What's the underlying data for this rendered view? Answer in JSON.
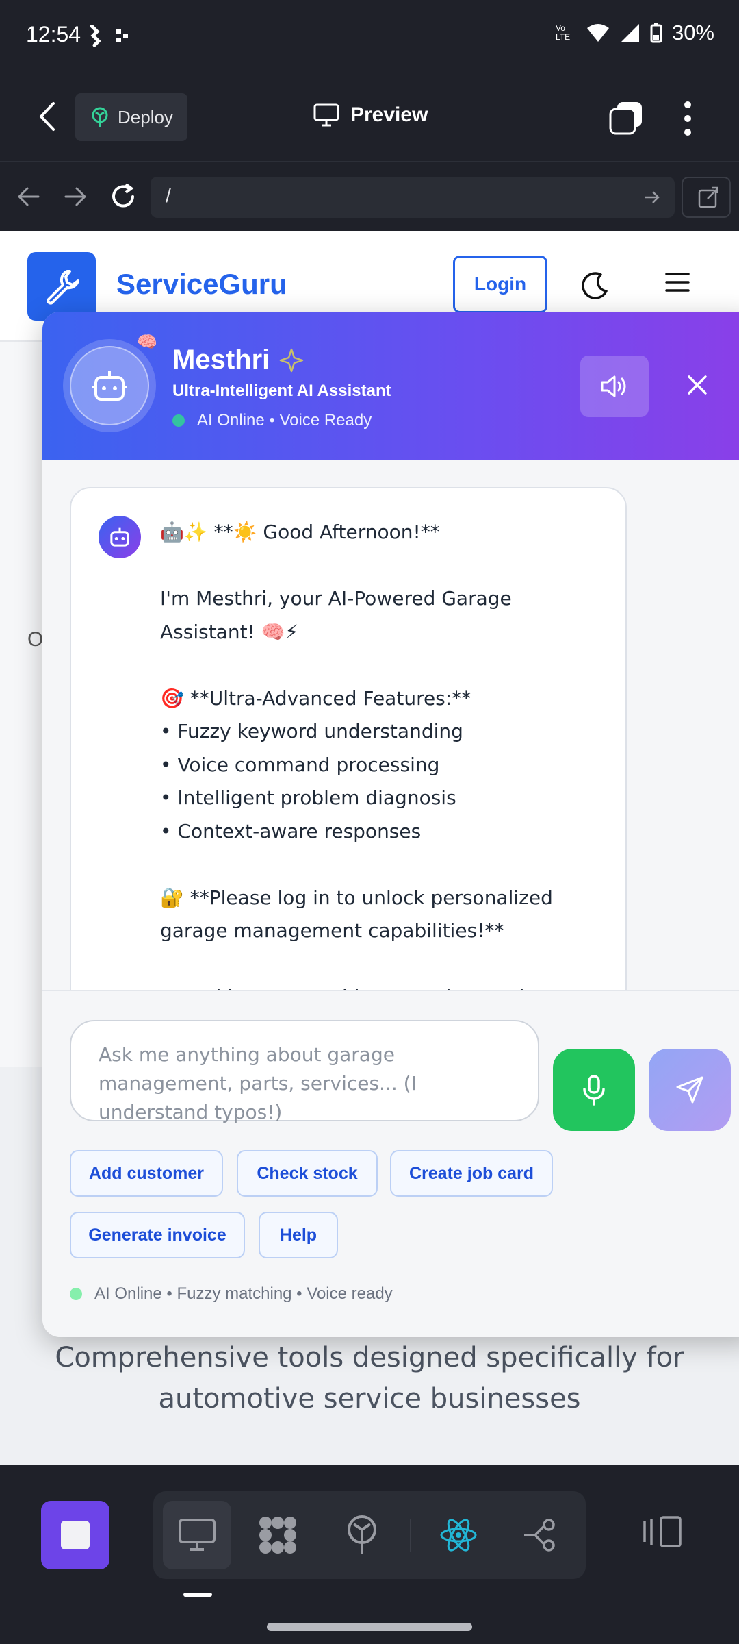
{
  "status_bar": {
    "time": "12:54",
    "battery": "30%",
    "network_label": "Vo LTE"
  },
  "toolbar": {
    "deploy_label": "Deploy",
    "preview_label": "Preview"
  },
  "url_bar": {
    "url": "/"
  },
  "site": {
    "brand": "ServiceGuru",
    "login_label": "Login",
    "hidden_text": "O",
    "tagline": "Comprehensive tools designed specifically for automotive service businesses"
  },
  "chat": {
    "bot_name": "Mesthri",
    "subtitle": "Ultra-Intelligent AI Assistant",
    "status": "AI Online • Voice Ready",
    "message": "🤖✨ **☀️ Good Afternoon!**\n\nI'm Mesthri, your AI-Powered Garage Assistant! 🧠⚡\n\n🎯 **Ultra-Advanced Features:**\n• Fuzzy keyword understanding\n• Voice command processing\n• Intelligent problem diagnosis\n• Context-aware responses\n\n🔐 **Please log in to unlock personalized garage management capabilities!**\n\nTry asking me anything - I understand typos and",
    "input_placeholder": "Ask me anything about garage management, parts, services... (I understand typos!)",
    "quick_actions": [
      "Add customer",
      "Check stock",
      "Create job card",
      "Generate invoice",
      "Help"
    ],
    "footer_status": "AI Online • Fuzzy matching • Voice ready"
  },
  "colors": {
    "accent": "#2563eb",
    "header_gradient_start": "#3b63f0",
    "header_gradient_end": "#8b3fe8",
    "mic_green": "#22c55e",
    "stop_purple": "#6d44e8"
  }
}
